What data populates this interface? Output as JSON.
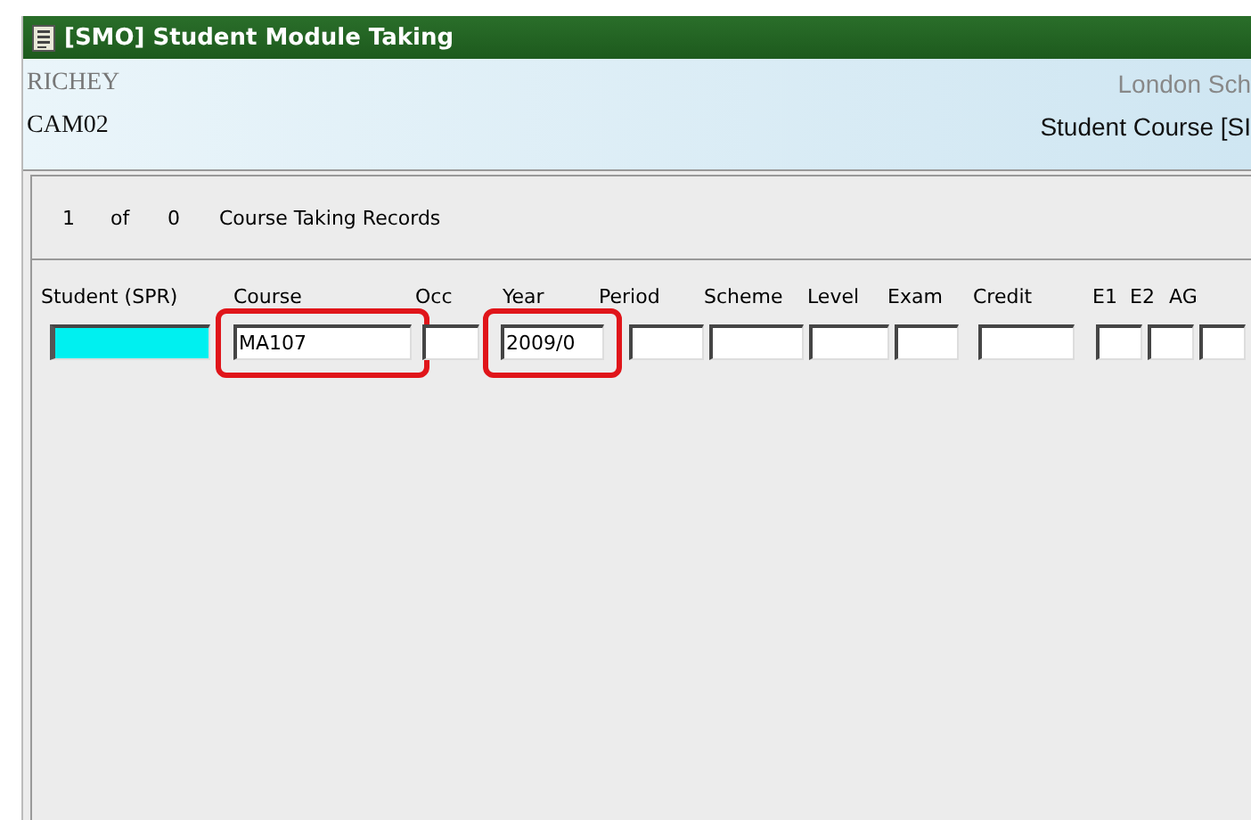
{
  "window": {
    "title": "[SMO] Student Module Taking"
  },
  "header": {
    "user": "RICHEY",
    "institution": "London Sch",
    "code": "CAM02",
    "form": "Student Course [SI"
  },
  "records": {
    "current": "1",
    "of": "of",
    "total": "0",
    "label": "Course Taking Records"
  },
  "columns": [
    {
      "label": "Student (SPR)",
      "active": true,
      "highlighted": false
    },
    {
      "label": "Course",
      "value": "MA107",
      "active": false,
      "highlighted": true
    },
    {
      "label": "Occ",
      "active": false,
      "highlighted": false
    },
    {
      "label": "Year",
      "value": "2009/0",
      "active": false,
      "highlighted": true
    },
    {
      "label": "Period",
      "active": false,
      "highlighted": false
    },
    {
      "label": "Scheme",
      "active": false,
      "highlighted": false
    },
    {
      "label": "Level",
      "active": false,
      "highlighted": false
    },
    {
      "label": "Exam",
      "active": false,
      "highlighted": false
    },
    {
      "label": "Credit",
      "active": false,
      "highlighted": false
    },
    {
      "label": "E1",
      "active": false,
      "highlighted": false
    },
    {
      "label": "E2",
      "active": false,
      "highlighted": false
    },
    {
      "label": "AG",
      "active": false,
      "highlighted": false
    }
  ]
}
